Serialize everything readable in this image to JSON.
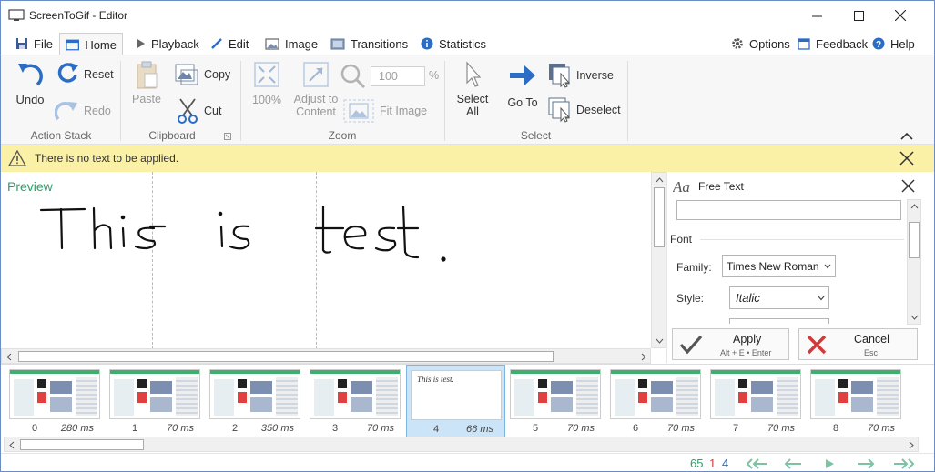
{
  "window": {
    "title": "ScreenToGif - Editor",
    "controls": [
      "minimize-icon",
      "maximize-icon",
      "close-icon"
    ]
  },
  "tabs": [
    {
      "label": "File",
      "icon": "save-icon"
    },
    {
      "label": "Home",
      "icon": "home-icon",
      "active": true
    },
    {
      "label": "Playback",
      "icon": "play-icon"
    },
    {
      "label": "Edit",
      "icon": "pencil-icon"
    },
    {
      "label": "Image",
      "icon": "image-icon"
    },
    {
      "label": "Transitions",
      "icon": "transitions-icon"
    },
    {
      "label": "Statistics",
      "icon": "info-icon"
    }
  ],
  "top_right": {
    "options": "Options",
    "feedback": "Feedback",
    "help": "Help"
  },
  "ribbon": {
    "action_stack": {
      "label": "Action Stack",
      "undo": "Undo",
      "reset": "Reset",
      "redo": "Redo"
    },
    "clipboard": {
      "label": "Clipboard",
      "paste": "Paste",
      "copy": "Copy",
      "cut": "Cut"
    },
    "zoom": {
      "label": "Zoom",
      "hundred": "100%",
      "adjust_line1": "Adjust to",
      "adjust_line2": "Content",
      "fit_image": "Fit Image",
      "zoom_value": "100",
      "percent": "%"
    },
    "select": {
      "label": "Select",
      "select_all_line1": "Select",
      "select_all_line2": "All",
      "go_to": "Go To",
      "inverse": "Inverse",
      "deselect": "Deselect"
    }
  },
  "warning": {
    "text": "There is no text to be applied."
  },
  "preview": {
    "label": "Preview",
    "canvas_text": "This is test."
  },
  "free_text_panel": {
    "title": "Free Text",
    "text_value": "",
    "font_section": "Font",
    "family_label": "Family:",
    "family_value": "Times New Roman",
    "style_label": "Style:",
    "style_value": "Italic",
    "apply": "Apply",
    "apply_shortcut": "Alt + E • Enter",
    "cancel": "Cancel",
    "cancel_shortcut": "Esc"
  },
  "frames": [
    {
      "index": "0",
      "duration": "280 ms",
      "kind": "screenshot"
    },
    {
      "index": "1",
      "duration": "70 ms",
      "kind": "screenshot"
    },
    {
      "index": "2",
      "duration": "350 ms",
      "kind": "screenshot"
    },
    {
      "index": "3",
      "duration": "70 ms",
      "kind": "screenshot"
    },
    {
      "index": "4",
      "duration": "66 ms",
      "kind": "text",
      "selected": true,
      "thumb_text": "This is test."
    },
    {
      "index": "5",
      "duration": "70 ms",
      "kind": "screenshot"
    },
    {
      "index": "6",
      "duration": "70 ms",
      "kind": "screenshot"
    },
    {
      "index": "7",
      "duration": "70 ms",
      "kind": "screenshot"
    },
    {
      "index": "8",
      "duration": "70 ms",
      "kind": "screenshot"
    }
  ],
  "status": {
    "total_frames": "65",
    "selected_count": "1",
    "current_frame": "4"
  },
  "colors": {
    "accent_blue": "#2b6cc4",
    "preview_label_green": "#2e9e6a",
    "warning_bg": "#fbf1a6",
    "status_total": "#2e9e6a",
    "status_selected": "#d23a3a",
    "status_current": "#2b6cc4",
    "nav_arrows": "#7fc2a3"
  }
}
